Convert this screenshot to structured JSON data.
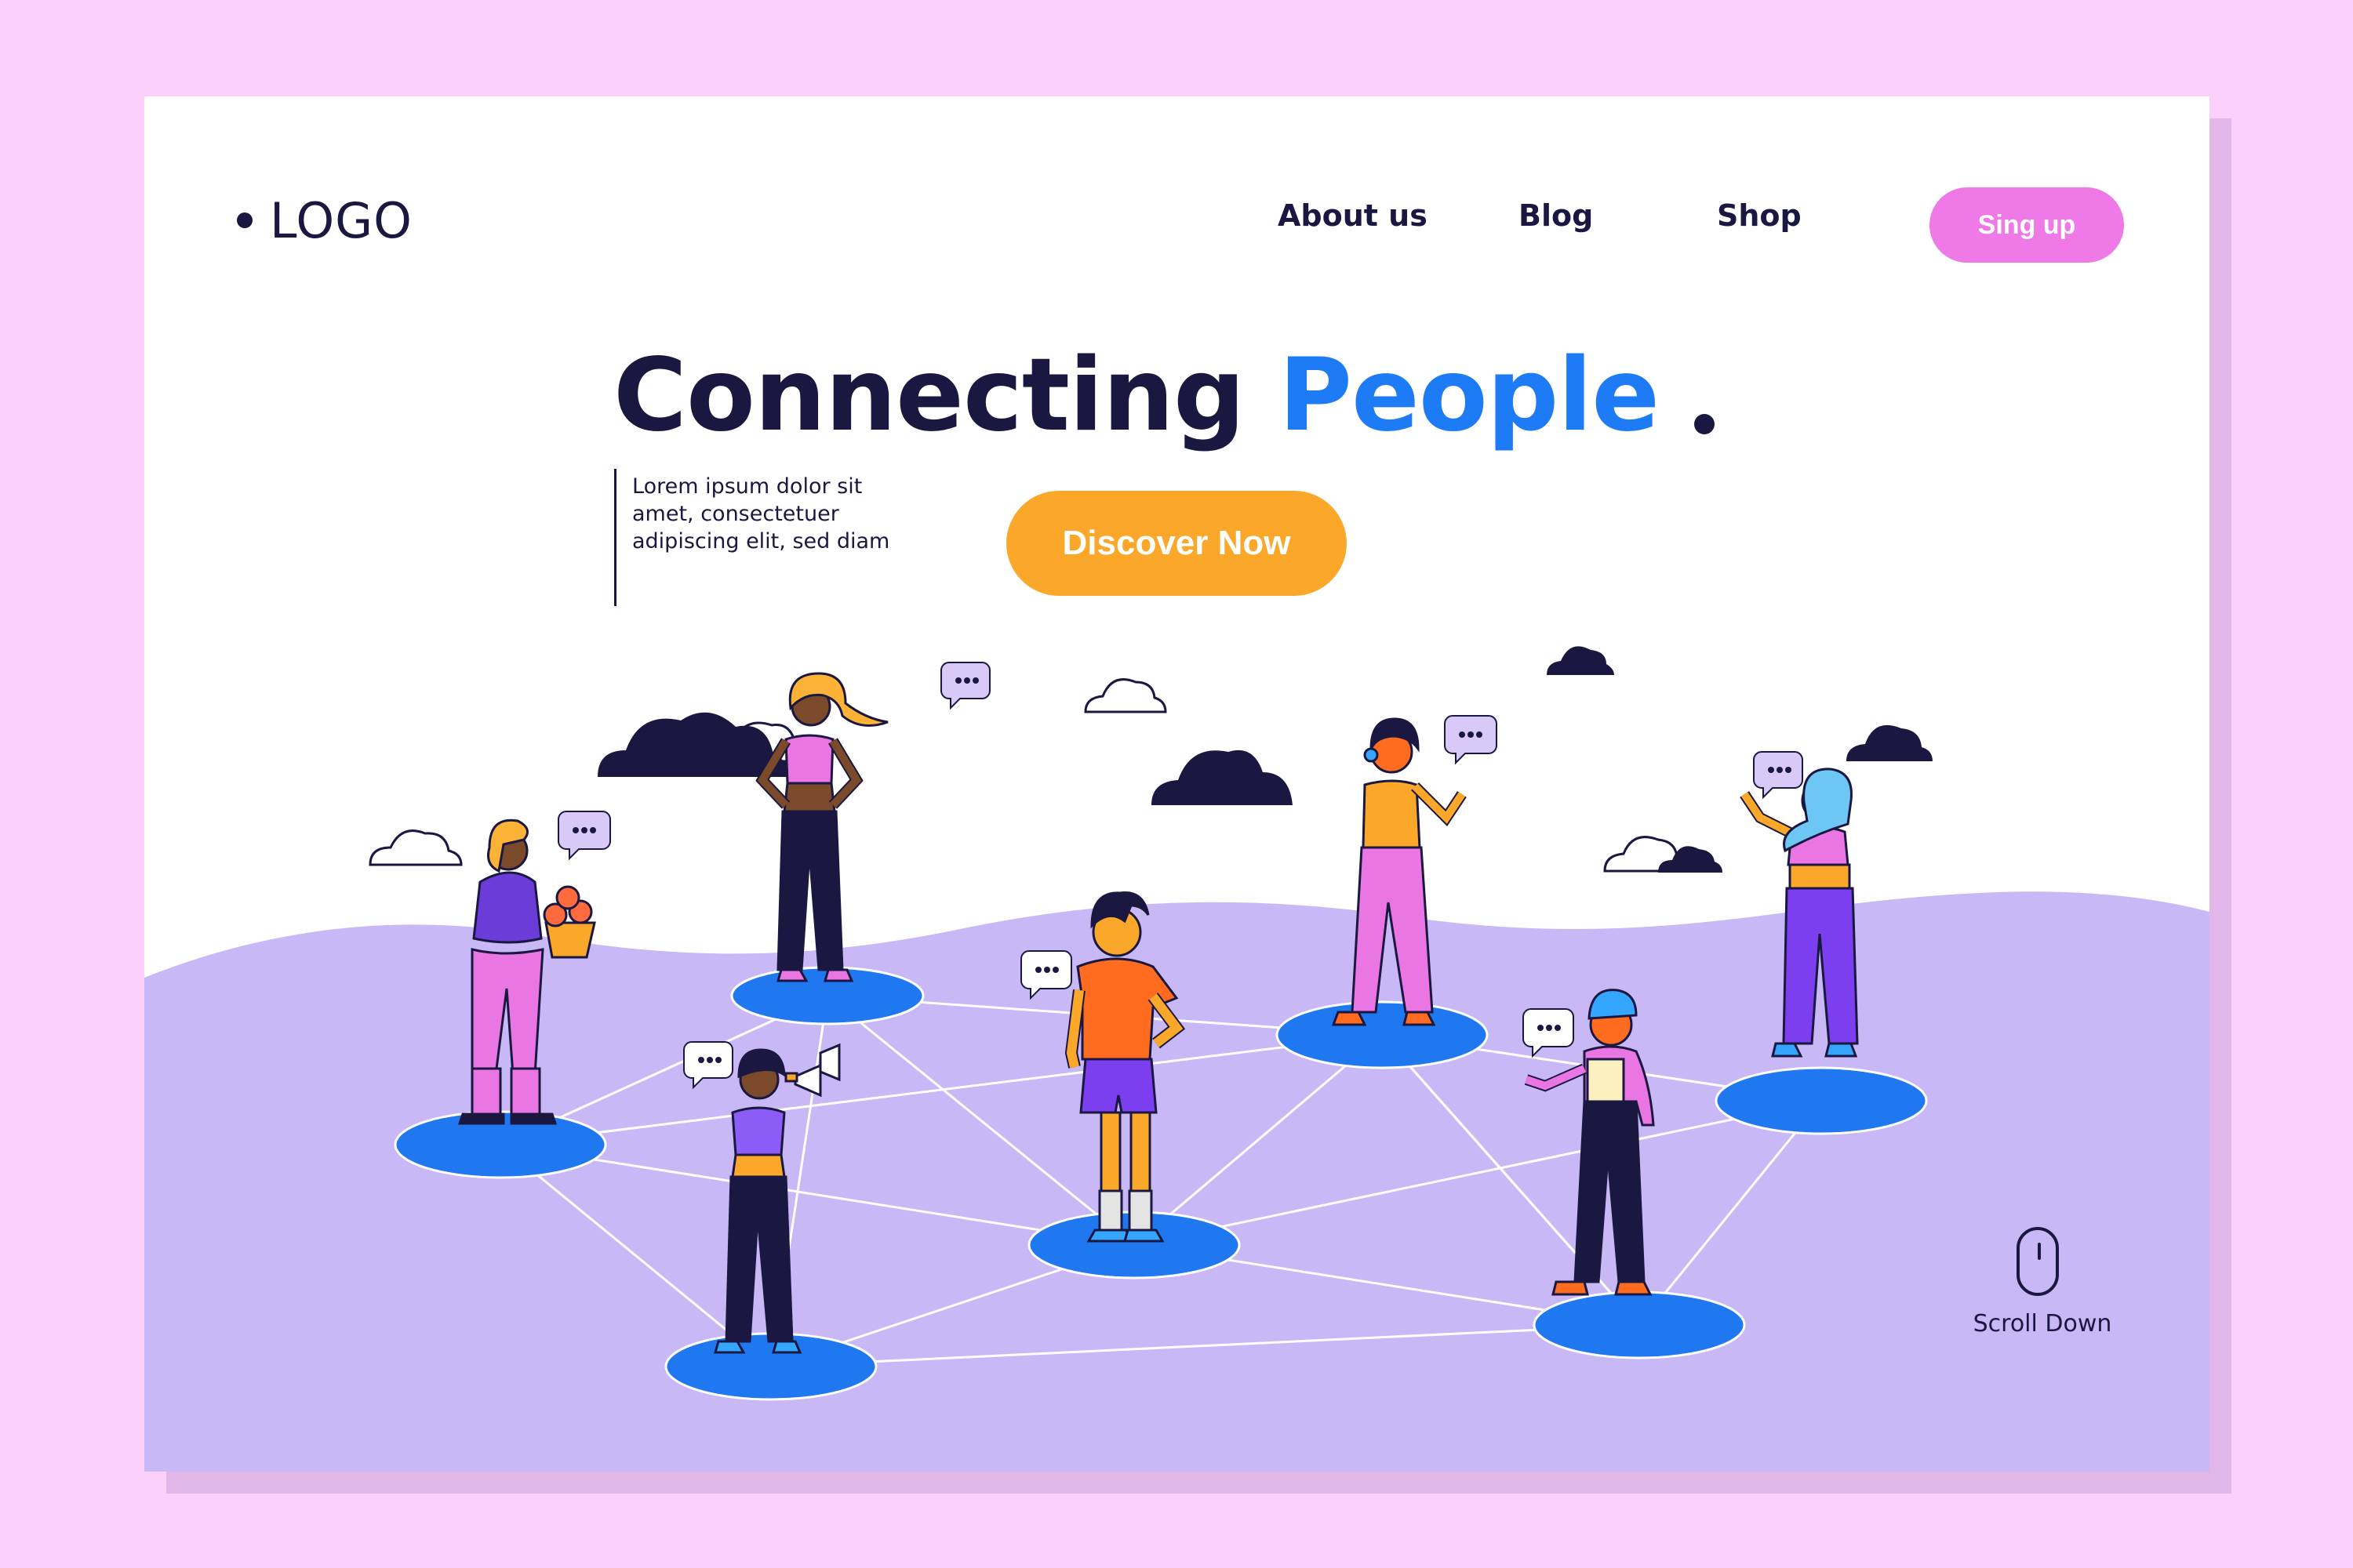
{
  "brand": {
    "logo": "LOGO"
  },
  "nav": {
    "items": [
      {
        "label": "About us"
      },
      {
        "label": "Blog"
      },
      {
        "label": "Shop"
      }
    ],
    "signup_label": "Sing up"
  },
  "hero": {
    "title_main": "Connecting",
    "title_accent": "People",
    "subtitle_line1": "Lorem ipsum dolor sit",
    "subtitle_line2": "amet, consectetuer",
    "subtitle_line3": "adipiscing elit, sed diam",
    "cta_label": "Discover Now"
  },
  "scroll": {
    "label": "Scroll Down"
  },
  "colors": {
    "background": "#fbd0fb",
    "card": "#ffffff",
    "ground": "#c9b8f6",
    "platform": "#1f78f0",
    "navy": "#1a1840",
    "accent_blue": "#1d7cf5",
    "cta_orange": "#fba82a",
    "signup_pink": "#ef79e6"
  },
  "icons": [
    "logo-dot-icon",
    "cloud-icon",
    "speech-bubble-icon",
    "megaphone-icon",
    "flower-pot-icon",
    "mouse-icon"
  ]
}
